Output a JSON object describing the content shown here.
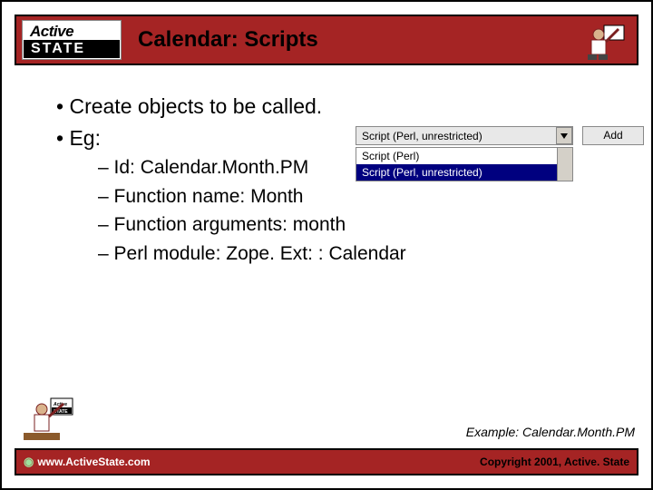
{
  "header": {
    "logo_top": "Active",
    "logo_bottom": "STATE",
    "title": "Calendar: Scripts"
  },
  "bullets": {
    "l1a": "Create objects to be called.",
    "l1b": "Eg:",
    "l2a": "Id: Calendar.Month.PM",
    "l2b": "Function name: Month",
    "l2c": "Function arguments: month",
    "l2d": "Perl module: Zope. Ext: : Calendar"
  },
  "ui": {
    "dropdown_value": "Script (Perl, unrestricted)",
    "add_label": "Add",
    "list_plain": "Script (Perl)",
    "list_selected": "Script (Perl, unrestricted)"
  },
  "caption": "Example: Calendar.Month.PM",
  "footer": {
    "url": "www.ActiveState.com",
    "copyright": "Copyright 2001, Active. State"
  }
}
